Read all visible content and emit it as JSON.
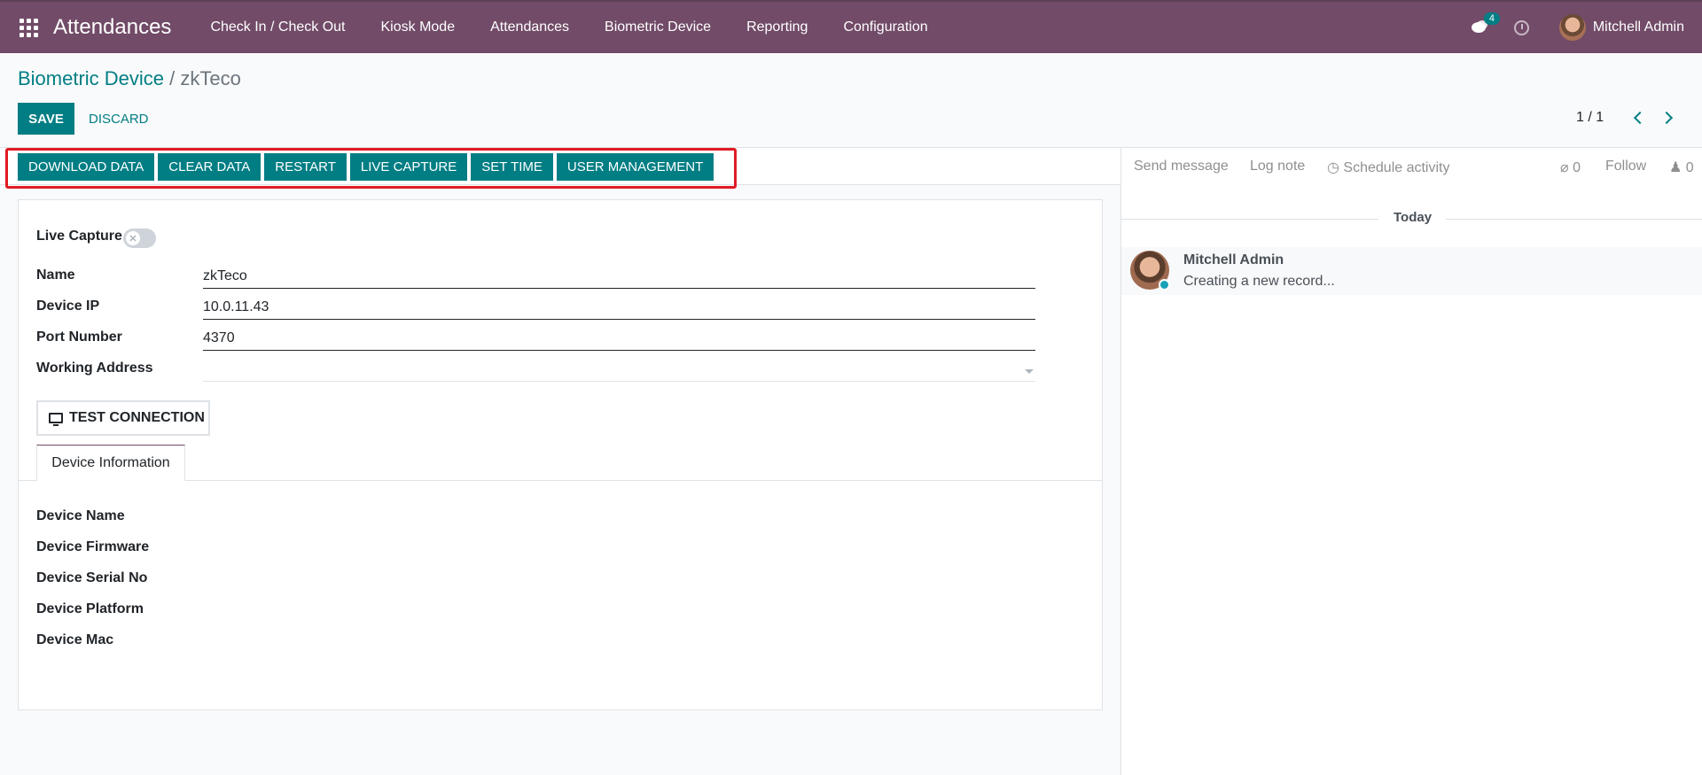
{
  "navbar": {
    "brand": "Attendances",
    "menu": [
      "Check In / Check Out",
      "Kiosk Mode",
      "Attendances",
      "Biometric Device",
      "Reporting",
      "Configuration"
    ],
    "chat_count": "4",
    "user": "Mitchell Admin"
  },
  "breadcrumb": {
    "parent": "Biometric Device",
    "separator": "/",
    "current": "zkTeco"
  },
  "control": {
    "save": "SAVE",
    "discard": "DISCARD",
    "pager": "1 / 1"
  },
  "header_buttons": [
    "DOWNLOAD DATA",
    "CLEAR DATA",
    "RESTART",
    "LIVE CAPTURE",
    "SET TIME",
    "USER MANAGEMENT"
  ],
  "form": {
    "live_capture_label": "Live Capture",
    "live_capture_value": false,
    "fields": [
      {
        "label": "Name",
        "value": "zkTeco"
      },
      {
        "label": "Device IP",
        "value": "10.0.11.43"
      },
      {
        "label": "Port Number",
        "value": "4370"
      },
      {
        "label": "Working Address",
        "value": ""
      }
    ],
    "test_button": "TEST CONNECTION",
    "tab": "Device Information",
    "device_fields": [
      "Device Name",
      "Device Firmware",
      "Device Serial No",
      "Device Platform",
      "Device Mac"
    ]
  },
  "chatter": {
    "send_message": "Send message",
    "log_note": "Log note",
    "schedule_activity": "Schedule activity",
    "attachments": "0",
    "follow": "Follow",
    "followers": "0",
    "date_separator": "Today",
    "message": {
      "author": "Mitchell Admin",
      "body": "Creating a new record..."
    }
  },
  "colors": {
    "navbar": "#714b67",
    "primary": "#017e84",
    "highlight": "#e01b24"
  }
}
